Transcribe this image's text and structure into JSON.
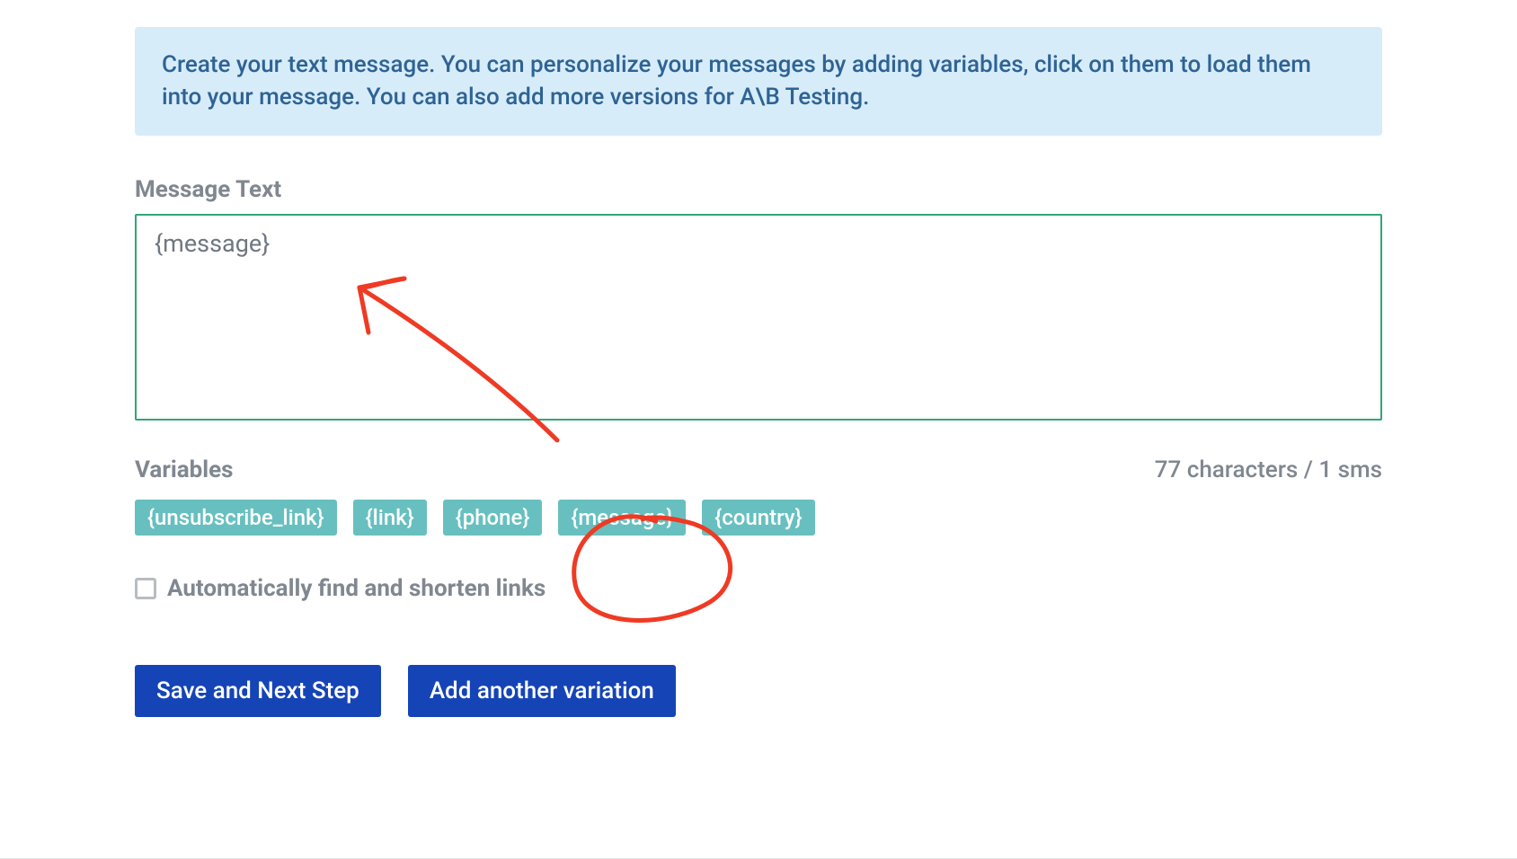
{
  "banner": {
    "text": "Create your text message. You can personalize your messages by adding variables, click on them to load them into your message. You can also add more versions for A\\B Testing."
  },
  "message": {
    "label": "Message Text",
    "value": "{message}"
  },
  "variables": {
    "label": "Variables",
    "items": [
      "{unsubscribe_link}",
      "{link}",
      "{phone}",
      "{message}",
      "{country}"
    ]
  },
  "char_count": "77 characters / 1 sms",
  "checkbox": {
    "checked": false,
    "label": "Automatically find and shorten links"
  },
  "buttons": {
    "save": "Save and Next Step",
    "add_variation": "Add another variation"
  }
}
